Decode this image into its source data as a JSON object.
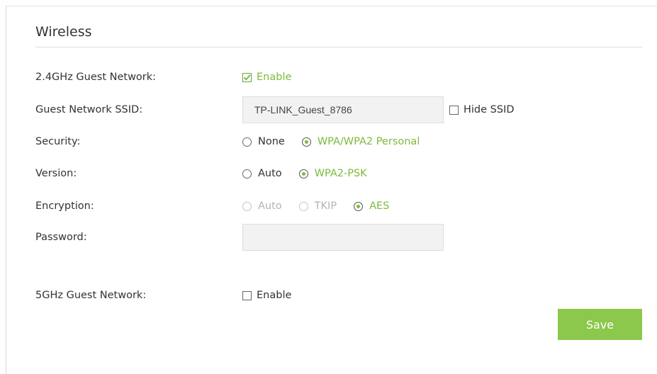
{
  "section": {
    "title": "Wireless"
  },
  "guest24": {
    "label": "2.4GHz Guest Network:",
    "enable": {
      "label": "Enable",
      "checked": true
    }
  },
  "ssid": {
    "label": "Guest Network SSID:",
    "value": "TP-LINK_Guest_8786",
    "hide_ssid": {
      "label": "Hide SSID",
      "checked": false
    }
  },
  "security": {
    "label": "Security:",
    "options": [
      {
        "label": "None",
        "selected": false
      },
      {
        "label": "WPA/WPA2 Personal",
        "selected": true
      }
    ]
  },
  "version": {
    "label": "Version:",
    "options": [
      {
        "label": "Auto",
        "selected": false
      },
      {
        "label": "WPA2-PSK",
        "selected": true
      }
    ]
  },
  "encryption": {
    "label": "Encryption:",
    "options": [
      {
        "label": "Auto",
        "selected": false,
        "disabled": true
      },
      {
        "label": "TKIP",
        "selected": false,
        "disabled": true
      },
      {
        "label": "AES",
        "selected": true,
        "disabled": false
      }
    ]
  },
  "password": {
    "label": "Password:",
    "value": ""
  },
  "guest5": {
    "label": "5GHz Guest Network:",
    "enable": {
      "label": "Enable",
      "checked": false
    }
  },
  "actions": {
    "save_label": "Save"
  },
  "colors": {
    "accent": "#7dba3d",
    "button": "#8cc84b",
    "disabled": "#b4b4b4"
  }
}
